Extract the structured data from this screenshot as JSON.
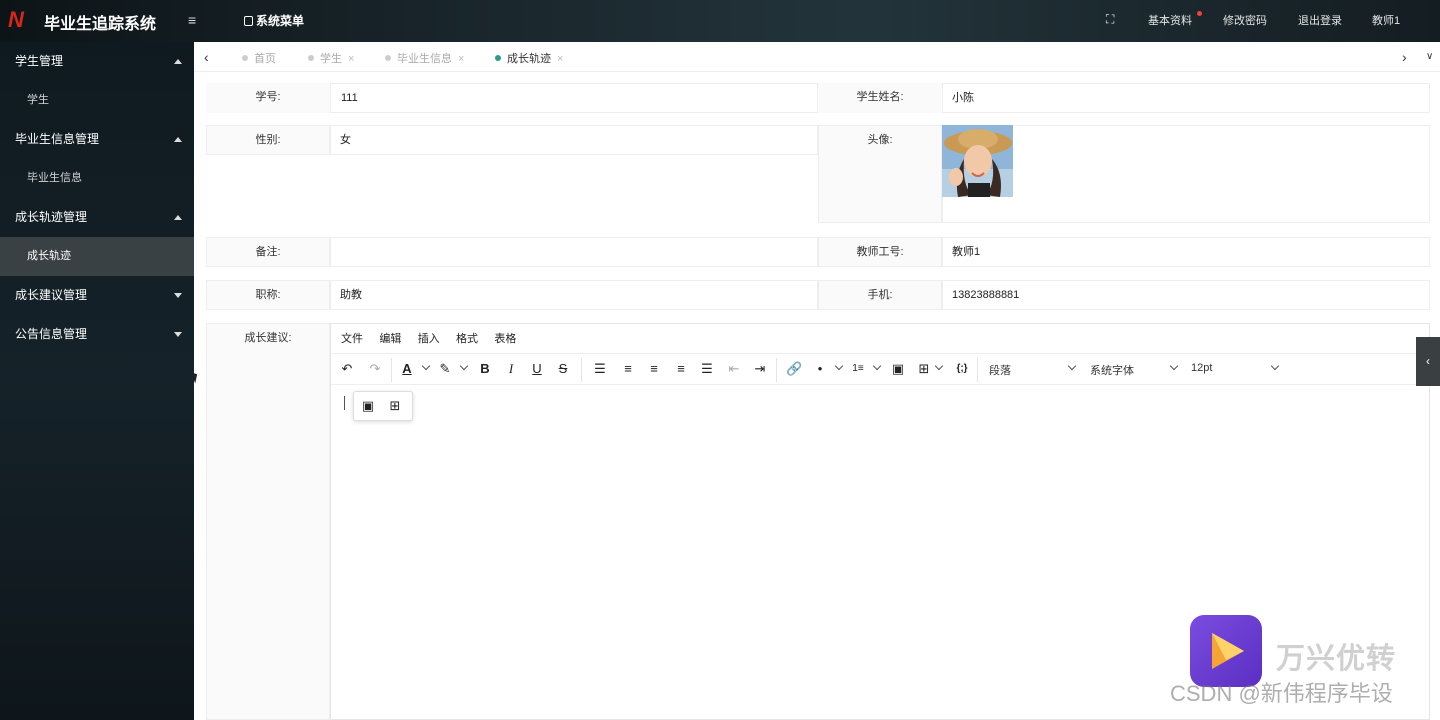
{
  "header": {
    "title": "毕业生追踪系统",
    "logo_letter": "N",
    "menu_title": "系统菜单",
    "basic_info": "基本资料",
    "change_password": "修改密码",
    "logout": "退出登录",
    "user": "教师1"
  },
  "sidebar": {
    "groups": [
      {
        "label": "学生管理",
        "expanded": true,
        "items": [
          "学生"
        ]
      },
      {
        "label": "毕业生信息管理",
        "expanded": true,
        "items": [
          "毕业生信息"
        ]
      },
      {
        "label": "成长轨迹管理",
        "expanded": true,
        "items": [
          "成长轨迹"
        ]
      },
      {
        "label": "成长建议管理",
        "expanded": false,
        "items": []
      },
      {
        "label": "公告信息管理",
        "expanded": false,
        "items": []
      }
    ],
    "active_item": "成长轨迹"
  },
  "tabs": [
    {
      "label": "首页",
      "active": false,
      "closable": false
    },
    {
      "label": "学生",
      "active": false,
      "closable": true
    },
    {
      "label": "毕业生信息",
      "active": false,
      "closable": true
    },
    {
      "label": "成长轨迹",
      "active": true,
      "closable": true
    }
  ],
  "form": {
    "student_no_label": "学号:",
    "student_no": "111",
    "student_name_label": "学生姓名:",
    "student_name": "小陈",
    "gender_label": "性别:",
    "gender": "女",
    "avatar_label": "头像:",
    "remark_label": "备注:",
    "remark": "",
    "teacher_no_label": "教师工号:",
    "teacher_no": "教师1",
    "title_label": "职称:",
    "title": "助教",
    "phone_label": "手机:",
    "phone": "13823888881",
    "suggestion_label": "成长建议:"
  },
  "editor": {
    "menus": [
      "文件",
      "编辑",
      "插入",
      "格式",
      "表格"
    ],
    "block_format": "段落",
    "font_family": "系统字体",
    "font_size": "12pt"
  },
  "watermark": {
    "brand": "万兴优转",
    "csdn": "CSDN @新伟程序毕设"
  },
  "colors": {
    "active_tab_dot": "#2a9d8f",
    "notification_dot": "#f0433a",
    "sidebar_active_bg": "#3a4144"
  }
}
